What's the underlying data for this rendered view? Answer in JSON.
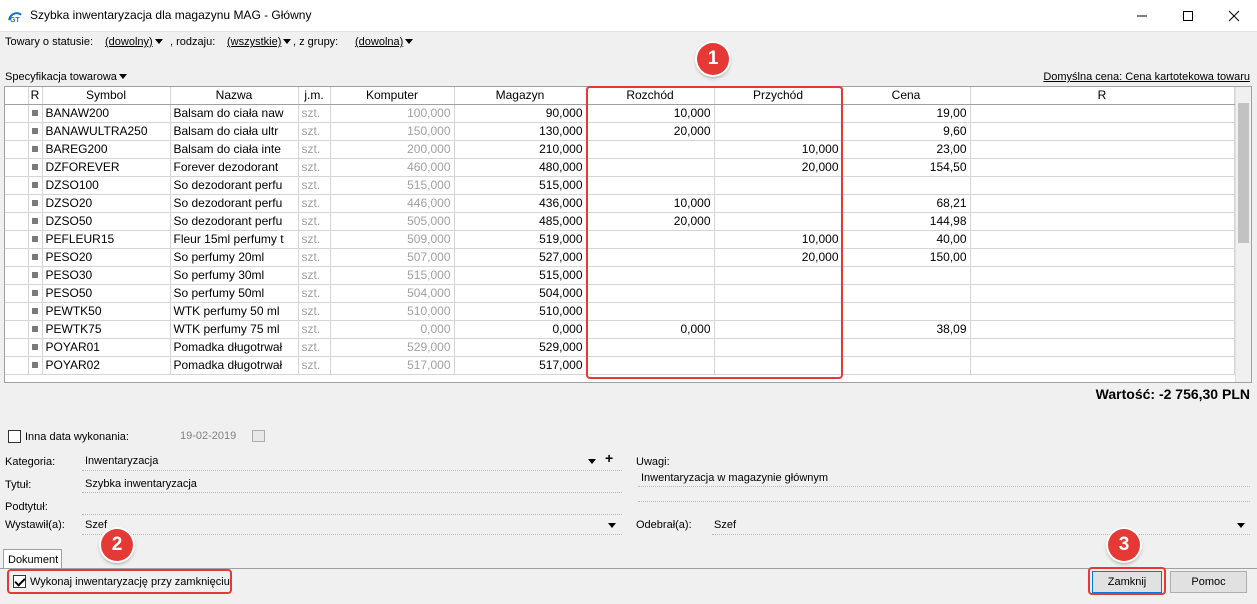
{
  "window": {
    "title": "Szybka inwentaryzacja dla magazynu MAG - Główny"
  },
  "filters": {
    "status_label": "Towary o statusie:",
    "status_value": "(dowolny)",
    "type_label": ", rodzaju:",
    "type_value": "(wszystkie)",
    "group_label": ", z grupy:",
    "group_value": "(dowolna)"
  },
  "spec_label": "Specyfikacja towarowa",
  "default_price": "Domyślna cena: Cena kartotekowa towaru",
  "grid": {
    "columns": [
      "R",
      "Symbol",
      "Nazwa",
      "j.m.",
      "Komputer",
      "Magazyn",
      "Rozchód",
      "Przychód",
      "Cena",
      "R"
    ],
    "rows": [
      {
        "symbol": "BANAW200",
        "nazwa": "Balsam do ciała naw",
        "jm": "szt.",
        "komputer": "100,000",
        "magazyn": "90,000",
        "rozchod": "10,000",
        "przychod": "",
        "cena": "19,00"
      },
      {
        "symbol": "BANAWULTRA250",
        "nazwa": "Balsam do ciała ultr",
        "jm": "szt.",
        "komputer": "150,000",
        "magazyn": "130,000",
        "rozchod": "20,000",
        "przychod": "",
        "cena": "9,60"
      },
      {
        "symbol": "BAREG200",
        "nazwa": "Balsam do ciała inte",
        "jm": "szt.",
        "komputer": "200,000",
        "magazyn": "210,000",
        "rozchod": "",
        "przychod": "10,000",
        "cena": "23,00"
      },
      {
        "symbol": "DZFOREVER",
        "nazwa": "Forever dezodorant",
        "jm": "szt.",
        "komputer": "460,000",
        "magazyn": "480,000",
        "rozchod": "",
        "przychod": "20,000",
        "cena": "154,50"
      },
      {
        "symbol": "DZSO100",
        "nazwa": "So dezodorant perfu",
        "jm": "szt.",
        "komputer": "515,000",
        "magazyn": "515,000",
        "rozchod": "",
        "przychod": "",
        "cena": ""
      },
      {
        "symbol": "DZSO20",
        "nazwa": "So dezodorant perfu",
        "jm": "szt.",
        "komputer": "446,000",
        "magazyn": "436,000",
        "rozchod": "10,000",
        "przychod": "",
        "cena": "68,21"
      },
      {
        "symbol": "DZSO50",
        "nazwa": "So dezodorant perfu",
        "jm": "szt.",
        "komputer": "505,000",
        "magazyn": "485,000",
        "rozchod": "20,000",
        "przychod": "",
        "cena": "144,98"
      },
      {
        "symbol": "PEFLEUR15",
        "nazwa": "Fleur 15ml perfumy t",
        "jm": "szt.",
        "komputer": "509,000",
        "magazyn": "519,000",
        "rozchod": "",
        "przychod": "10,000",
        "cena": "40,00"
      },
      {
        "symbol": "PESO20",
        "nazwa": "So perfumy 20ml",
        "jm": "szt.",
        "komputer": "507,000",
        "magazyn": "527,000",
        "rozchod": "",
        "przychod": "20,000",
        "cena": "150,00"
      },
      {
        "symbol": "PESO30",
        "nazwa": "So perfumy 30ml",
        "jm": "szt.",
        "komputer": "515,000",
        "magazyn": "515,000",
        "rozchod": "",
        "przychod": "",
        "cena": ""
      },
      {
        "symbol": "PESO50",
        "nazwa": "So perfumy 50ml",
        "jm": "szt.",
        "komputer": "504,000",
        "magazyn": "504,000",
        "rozchod": "",
        "przychod": "",
        "cena": ""
      },
      {
        "symbol": "PEWTK50",
        "nazwa": "WTK perfumy 50 ml",
        "jm": "szt.",
        "komputer": "510,000",
        "magazyn": "510,000",
        "rozchod": "",
        "przychod": "",
        "cena": ""
      },
      {
        "symbol": "PEWTK75",
        "nazwa": "WTK perfumy 75 ml",
        "jm": "szt.",
        "komputer": "0,000",
        "magazyn": "0,000",
        "rozchod": "0,000",
        "przychod": "",
        "cena": "38,09"
      },
      {
        "symbol": "POYAR01",
        "nazwa": "Pomadka długotrwał",
        "jm": "szt.",
        "komputer": "529,000",
        "magazyn": "529,000",
        "rozchod": "",
        "przychod": "",
        "cena": ""
      },
      {
        "symbol": "POYAR02",
        "nazwa": "Pomadka długotrwał",
        "jm": "szt.",
        "komputer": "517,000",
        "magazyn": "517,000",
        "rozchod": "",
        "przychod": "",
        "cena": ""
      }
    ]
  },
  "total": "Wartość: -2 756,30 PLN",
  "form": {
    "other_date_label": "Inna data wykonania:",
    "other_date_value": "19-02-2019",
    "kategoria_label": "Kategoria:",
    "kategoria_value": "Inwentaryzacja",
    "tytul_label": "Tytuł:",
    "tytul_value": "Szybka inwentaryzacja",
    "podtytul_label": "Podtytuł:",
    "wystawil_label": "Wystawił(a):",
    "wystawil_value": "Szef",
    "uwagi_label": "Uwagi:",
    "uwagi_value": "Inwentaryzacja w magazynie głównym",
    "odebral_label": "Odebrał(a):",
    "odebral_value": "Szef"
  },
  "tab_label": "Dokument",
  "footer": {
    "execute_label": "Wykonaj inwentaryzację przy zamknięciu",
    "close_label": "Zamknij",
    "help_label": "Pomoc"
  },
  "annotations": [
    "1",
    "2",
    "3"
  ],
  "colors": {
    "annotation_red": "#e53935",
    "focus_blue": "#0078d7"
  }
}
